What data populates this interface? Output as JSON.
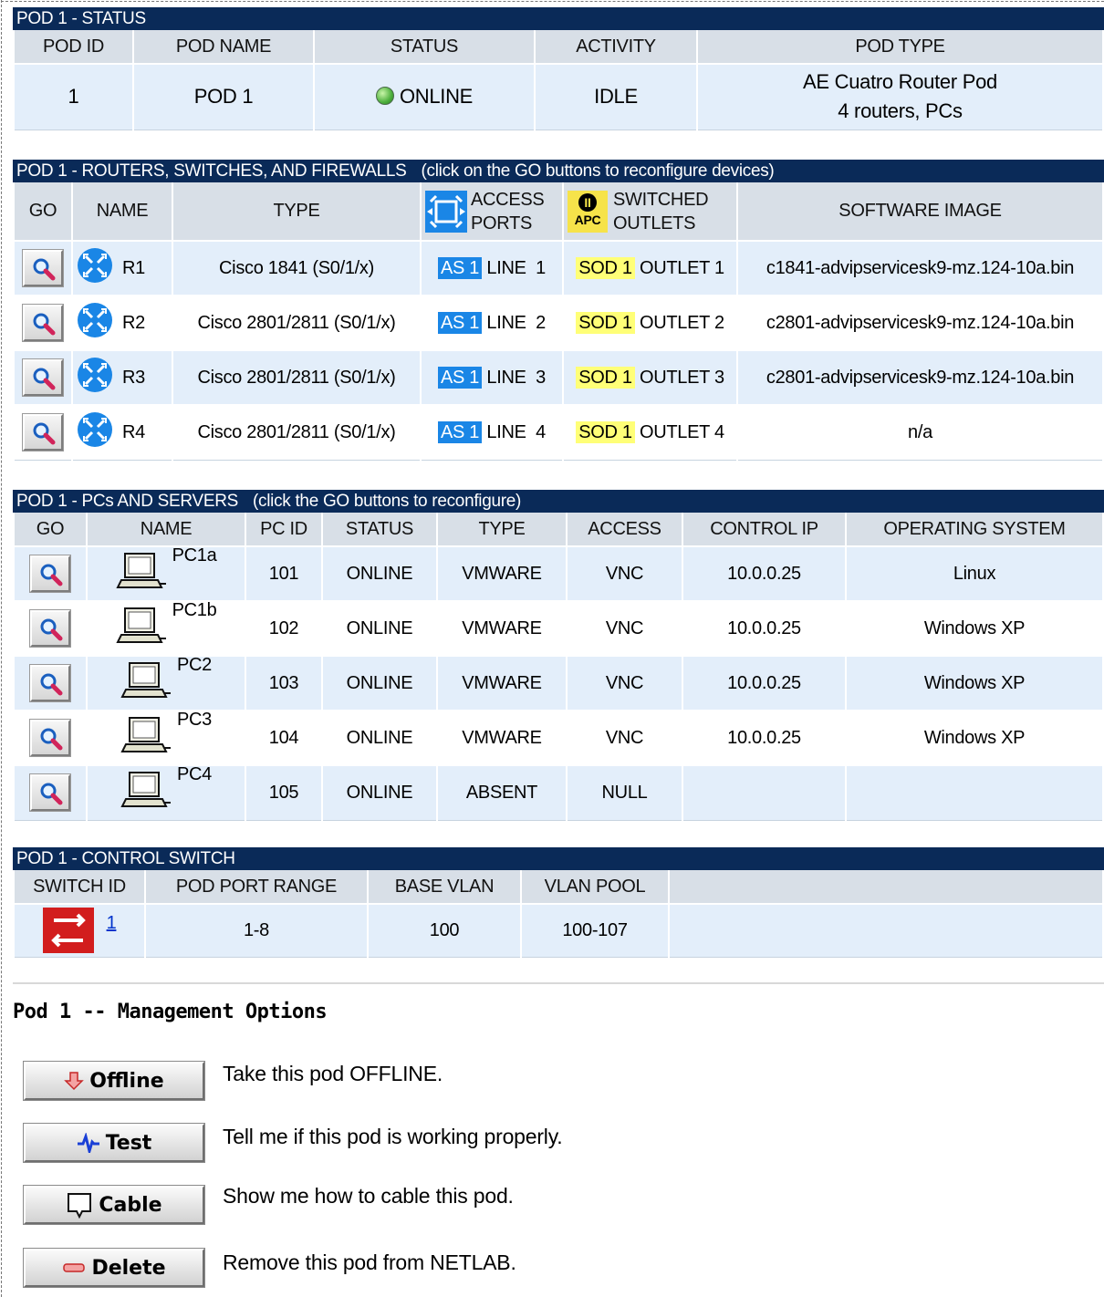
{
  "status_section": {
    "title": "POD 1 - STATUS",
    "headers": [
      "POD ID",
      "POD NAME",
      "STATUS",
      "ACTIVITY",
      "POD TYPE"
    ],
    "row": {
      "pod_id": "1",
      "pod_name": "POD 1",
      "status": "ONLINE",
      "activity": "IDLE",
      "pod_type_line1": "AE Cuatro Router Pod",
      "pod_type_line2": "4 routers, PCs"
    }
  },
  "routers_section": {
    "title": "POD 1 - ROUTERS, SWITCHES, AND FIREWALLS",
    "note": "(click on the GO buttons to reconfigure devices)",
    "headers": {
      "go": "GO",
      "name": "NAME",
      "type": "TYPE",
      "access_1": "ACCESS",
      "access_2": "PORTS",
      "switched_1": "SWITCHED",
      "switched_2": "OUTLETS",
      "image": "SOFTWARE IMAGE",
      "apc_badge": "APC"
    },
    "rows": [
      {
        "name": "R1",
        "type": "Cisco 1841 (S0/1/x)",
        "as": "AS 1",
        "line": "LINE  1",
        "sod": "SOD 1",
        "outlet": "OUTLET 1",
        "image": "c1841-advipservicesk9-mz.124-10a.bin"
      },
      {
        "name": "R2",
        "type": "Cisco 2801/2811 (S0/1/x)",
        "as": "AS 1",
        "line": "LINE  2",
        "sod": "SOD 1",
        "outlet": "OUTLET 2",
        "image": "c2801-advipservicesk9-mz.124-10a.bin"
      },
      {
        "name": "R3",
        "type": "Cisco 2801/2811 (S0/1/x)",
        "as": "AS 1",
        "line": "LINE  3",
        "sod": "SOD 1",
        "outlet": "OUTLET 3",
        "image": "c2801-advipservicesk9-mz.124-10a.bin"
      },
      {
        "name": "R4",
        "type": "Cisco 2801/2811 (S0/1/x)",
        "as": "AS 1",
        "line": "LINE  4",
        "sod": "SOD 1",
        "outlet": "OUTLET 4",
        "image": "n/a"
      }
    ]
  },
  "pcs_section": {
    "title": "POD 1 - PCs AND SERVERS",
    "note": "(click the GO buttons to reconfigure)",
    "headers": [
      "GO",
      "NAME",
      "PC ID",
      "STATUS",
      "TYPE",
      "ACCESS",
      "CONTROL IP",
      "OPERATING SYSTEM"
    ],
    "rows": [
      {
        "name": "PC1a",
        "id": "101",
        "status": "ONLINE",
        "type": "VMWARE",
        "access": "VNC",
        "ip": "10.0.0.25",
        "os": "Linux"
      },
      {
        "name": "PC1b",
        "id": "102",
        "status": "ONLINE",
        "type": "VMWARE",
        "access": "VNC",
        "ip": "10.0.0.25",
        "os": "Windows XP"
      },
      {
        "name": "PC2",
        "id": "103",
        "status": "ONLINE",
        "type": "VMWARE",
        "access": "VNC",
        "ip": "10.0.0.25",
        "os": "Windows XP"
      },
      {
        "name": "PC3",
        "id": "104",
        "status": "ONLINE",
        "type": "VMWARE",
        "access": "VNC",
        "ip": "10.0.0.25",
        "os": "Windows XP"
      },
      {
        "name": "PC4",
        "id": "105",
        "status": "ONLINE",
        "type": "ABSENT",
        "access": "NULL",
        "ip": "",
        "os": ""
      }
    ]
  },
  "switch_section": {
    "title": "POD 1 - CONTROL SWITCH",
    "headers": [
      "SWITCH ID",
      "POD PORT RANGE",
      "BASE VLAN",
      "VLAN POOL"
    ],
    "row": {
      "switch_id": "1",
      "port_range": "1-8",
      "base_vlan": "100",
      "vlan_pool": "100-107"
    }
  },
  "management": {
    "title": "Pod 1 -- Management Options",
    "buttons": [
      {
        "label": "Offline",
        "desc": "Take this pod OFFLINE."
      },
      {
        "label": "Test",
        "desc": "Tell me if this pod is working properly."
      },
      {
        "label": "Cable",
        "desc": "Show me how to cable this pod."
      },
      {
        "label": "Delete",
        "desc": "Remove this pod from NETLAB."
      }
    ]
  },
  "colors": {
    "header_bar": "#0a2a58",
    "column_header": "#d8dfe7",
    "row_shade": "#e3eefa",
    "as_label": "#1a86e6",
    "sod_label": "#ffff77",
    "online_indicator": "#4caf3c"
  }
}
